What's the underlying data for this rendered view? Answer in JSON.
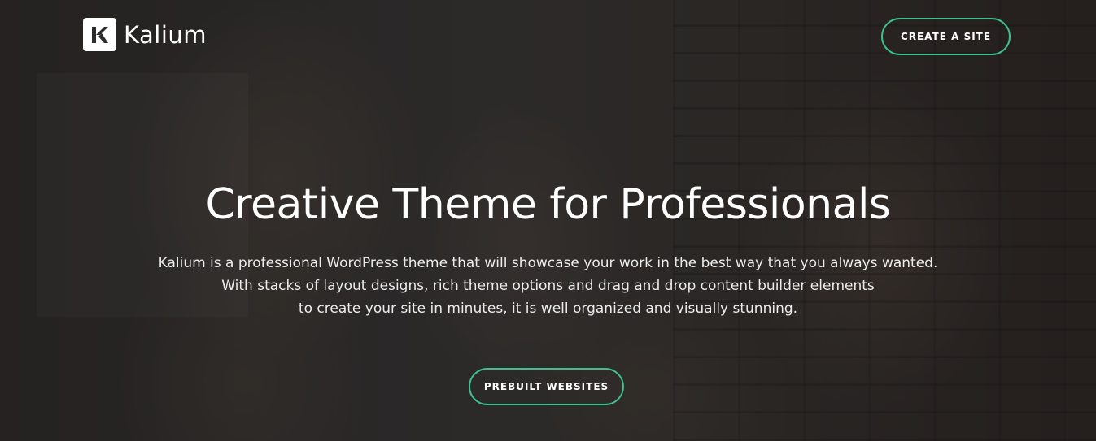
{
  "header": {
    "logo_text": "Kalium",
    "logo_icon": "kalium-k-logo-icon",
    "cta_label": "CREATE A SITE"
  },
  "hero": {
    "title": "Creative Theme for Professionals",
    "description_lines": [
      "Kalium is a professional WordPress theme that will showcase your work in the best way that you always wanted.",
      "With stacks of layout designs, rich theme options and drag and drop content builder elements",
      "to create your site in minutes, it is well organized and visually stunning."
    ],
    "button_label": "PREBUILT WEBSITES"
  },
  "colors": {
    "accent": "#3dbf8e",
    "text": "#ffffff"
  }
}
